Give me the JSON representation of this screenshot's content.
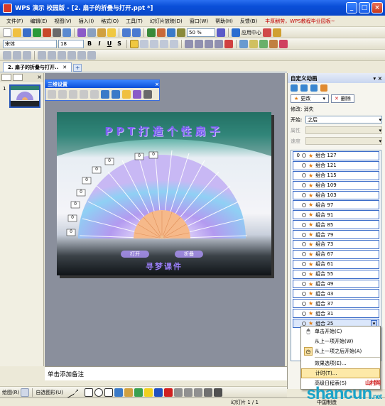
{
  "window": {
    "title": "WPS 演示 校园版 - [2. 扇子的折叠与打开.ppt *]"
  },
  "menubar": {
    "items": [
      "文件(F)",
      "编辑(E)",
      "视图(V)",
      "插入(I)",
      "格式(O)",
      "工具(T)",
      "幻灯片放映(D)",
      "窗口(W)",
      "帮助(H)",
      "反馈(B)"
    ],
    "promo": "丰厚酬劳，WPS教程毕业园板~"
  },
  "toolbar1": {
    "zoom": "50 %",
    "app_center": "应用中心"
  },
  "toolbar2": {
    "font_name": "宋体",
    "font_size": "18",
    "bold": "B",
    "italic": "I",
    "underline": "U",
    "strike": "S"
  },
  "doctab": {
    "label": "2. 扇子的折叠与打开.."
  },
  "thumbnail": {
    "number": "1"
  },
  "float_toolbar": {
    "title": "三维设置"
  },
  "slide": {
    "title": "PPT打造个性扇子",
    "buttons": [
      "打开",
      "折叠"
    ],
    "footer": "寻梦课件",
    "markers": [
      "0",
      "0",
      "0",
      "0",
      "0",
      "0",
      "0",
      "0",
      "0"
    ]
  },
  "notes": {
    "placeholder": "单击添加备注"
  },
  "task_pane": {
    "title": "自定义动画",
    "change_label": "更改",
    "delete_label": "删除",
    "modify_label": "修改: 消失",
    "start_label": "开始:",
    "start_value": "之后",
    "property_label": "属性",
    "speed_label": "速度",
    "items": [
      {
        "num": "0",
        "name": "组合 127"
      },
      {
        "num": "",
        "name": "组合 121"
      },
      {
        "num": "",
        "name": "组合 115"
      },
      {
        "num": "",
        "name": "组合 109"
      },
      {
        "num": "",
        "name": "组合 103"
      },
      {
        "num": "",
        "name": "组合 97"
      },
      {
        "num": "",
        "name": "组合 91"
      },
      {
        "num": "",
        "name": "组合 85"
      },
      {
        "num": "",
        "name": "组合 79"
      },
      {
        "num": "",
        "name": "组合 73"
      },
      {
        "num": "",
        "name": "组合 67"
      },
      {
        "num": "",
        "name": "组合 61"
      },
      {
        "num": "",
        "name": "组合 55"
      },
      {
        "num": "",
        "name": "组合 49"
      },
      {
        "num": "",
        "name": "组合 43"
      },
      {
        "num": "",
        "name": "组合 37"
      },
      {
        "num": "",
        "name": "组合 31"
      },
      {
        "num": "",
        "name": "组合 25"
      }
    ]
  },
  "context_menu": {
    "items": [
      "单击开始(C)",
      "从上一项开始(W)",
      "从上一项之后开始(A)",
      "效果选项(E)...",
      "计时(T)...",
      "高级日程表(S)"
    ]
  },
  "drawbar": {
    "draw_label": "绘图(R)",
    "autoshape_label": "自选图形(U)"
  },
  "statusbar": {
    "slide_info": "幻灯片 1 / 1",
    "theme": "中国制造"
  },
  "watermark": {
    "text": "shancun",
    "suffix": ".net",
    "cn": "山村网"
  }
}
